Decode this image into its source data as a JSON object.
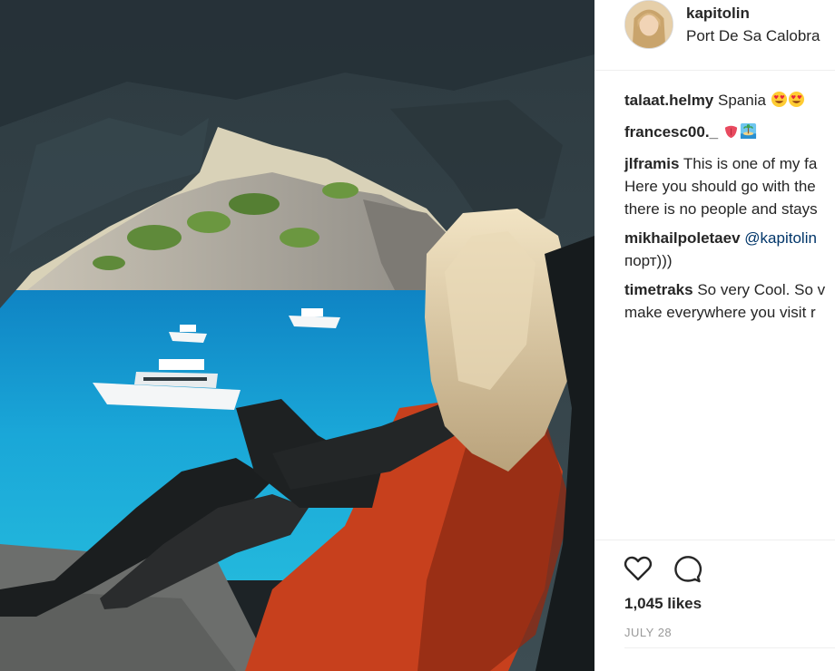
{
  "post": {
    "username": "kapitolin",
    "location": "Port De Sa Calobra"
  },
  "comments": [
    {
      "user": "talaat.helmy",
      "text": "Spania",
      "emoji": [
        "heart-eyes-emoji",
        "heart-eyes-emoji"
      ]
    },
    {
      "user": "francesc00._",
      "text": "",
      "emoji": [
        "tongue-emoji",
        "island-emoji"
      ]
    },
    {
      "user": "jlframis",
      "line1": "This is one of my fa",
      "line2": "Here you should go with the",
      "line3": "there is no people and stays"
    },
    {
      "user": "mikhailpoletaev",
      "mention": "@kapitolin",
      "line2": "порт)))"
    },
    {
      "user": "timetraks",
      "line1": "So very Cool. So v",
      "line2": "make everywhere you visit r"
    }
  ],
  "actions": {
    "like_icon": "heart-outline-icon",
    "comment_icon": "speech-bubble-icon"
  },
  "likes_label": "1,045 likes",
  "date_label": "JULY 28",
  "colors": {
    "text": "#262626",
    "mention": "#003569",
    "muted": "#999999",
    "divider": "#efefef",
    "sea": "#1ea2d6"
  }
}
